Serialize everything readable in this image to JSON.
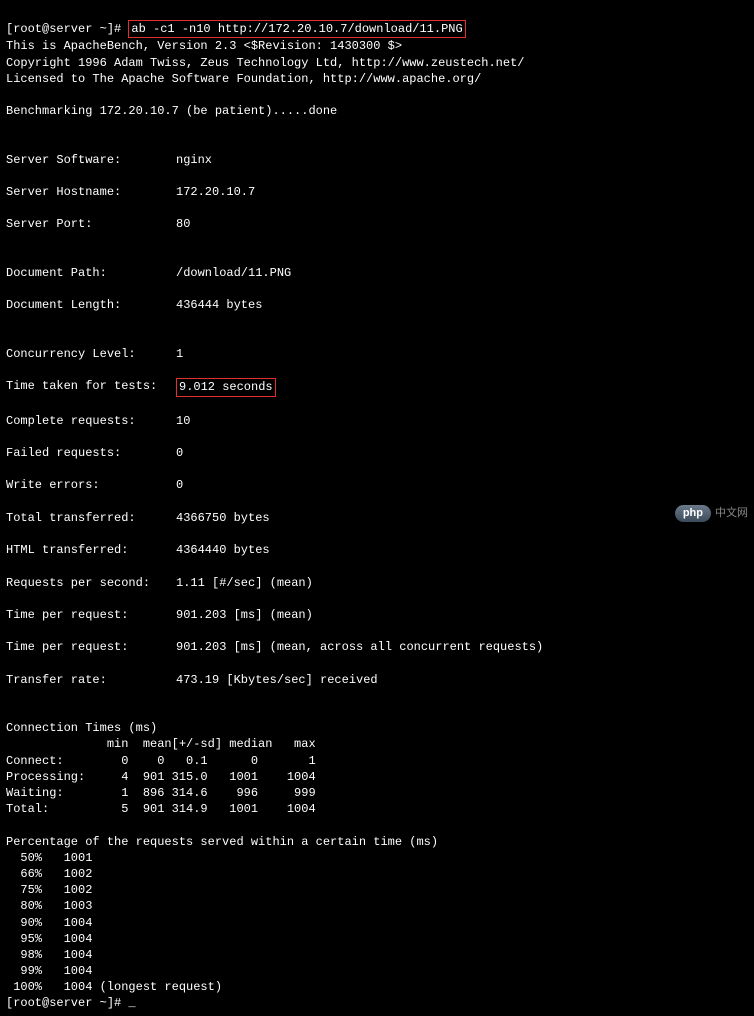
{
  "prompt_user": "[root@server ~]#",
  "command": "ab -c1 -n10 http://172.20.10.7/download/11.PNG",
  "header": {
    "line1": "This is ApacheBench, Version 2.3 <$Revision: 1430300 $>",
    "line2": "Copyright 1996 Adam Twiss, Zeus Technology Ltd, http://www.zeustech.net/",
    "line3": "Licensed to The Apache Software Foundation, http://www.apache.org/"
  },
  "benchmark_line": "Benchmarking 172.20.10.7 (be patient).....done",
  "server": {
    "software_label": "Server Software:",
    "software": "nginx",
    "hostname_label": "Server Hostname:",
    "hostname": "172.20.10.7",
    "port_label": "Server Port:",
    "port": "80"
  },
  "document": {
    "path_label": "Document Path:",
    "path": "/download/11.PNG",
    "length_label": "Document Length:",
    "length": "436444 bytes"
  },
  "results": {
    "concurrency_label": "Concurrency Level:",
    "concurrency": "1",
    "time_taken_label": "Time taken for tests:",
    "time_taken": "9.012 seconds",
    "complete_label": "Complete requests:",
    "complete": "10",
    "failed_label": "Failed requests:",
    "failed": "0",
    "write_errors_label": "Write errors:",
    "write_errors": "0",
    "total_transferred_label": "Total transferred:",
    "total_transferred": "4366750 bytes",
    "html_transferred_label": "HTML transferred:",
    "html_transferred": "4364440 bytes",
    "rps_label": "Requests per second:",
    "rps": "1.11 [#/sec] (mean)",
    "tpr1_label": "Time per request:",
    "tpr1": "901.203 [ms] (mean)",
    "tpr2_label": "Time per request:",
    "tpr2": "901.203 [ms] (mean, across all concurrent requests)",
    "transfer_label": "Transfer rate:",
    "transfer": "473.19 [Kbytes/sec] received"
  },
  "ctimes": {
    "title": "Connection Times (ms)",
    "head": "              min  mean[+/-sd] median   max",
    "rows": [
      "Connect:        0    0   0.1      0       1",
      "Processing:     4  901 315.0   1001    1004",
      "Waiting:        1  896 314.6    996     999",
      "Total:          5  901 314.9   1001    1004"
    ]
  },
  "pct": {
    "title": "Percentage of the requests served within a certain time (ms)",
    "rows": [
      "  50%   1001",
      "  66%   1002",
      "  75%   1002",
      "  80%   1003",
      "  90%   1004",
      "  95%   1004",
      "  98%   1004",
      "  99%   1004",
      " 100%   1004 (longest request)"
    ]
  },
  "prompt_end": "[root@server ~]# ",
  "cursor": "_",
  "watermark": {
    "badge": "php",
    "text": "中文网"
  }
}
